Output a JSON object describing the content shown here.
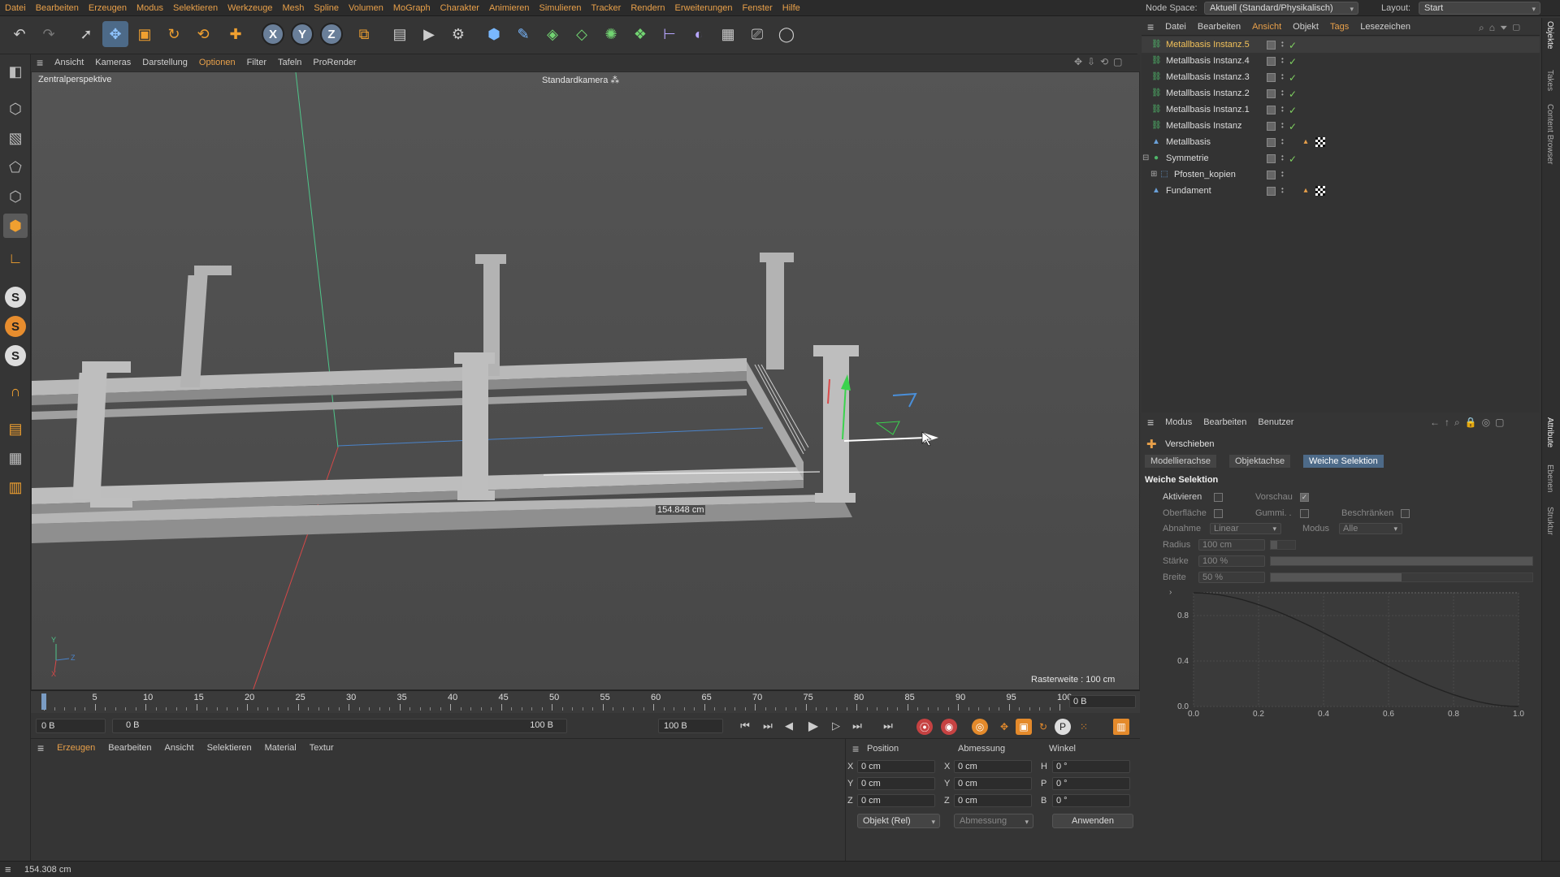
{
  "menubar": {
    "items": [
      "Datei",
      "Bearbeiten",
      "Erzeugen",
      "Modus",
      "Selektieren",
      "Werkzeuge",
      "Mesh",
      "Spline",
      "Volumen",
      "MoGraph",
      "Charakter",
      "Animieren",
      "Simulieren",
      "Tracker",
      "Rendern",
      "Erweiterungen",
      "Fenster",
      "Hilfe"
    ],
    "node_space_label": "Node Space:",
    "node_space_value": "Aktuell (Standard/Physikalisch)",
    "layout_label": "Layout:",
    "layout_value": "Start"
  },
  "viewport": {
    "menu": [
      "Ansicht",
      "Kameras",
      "Darstellung",
      "Optionen",
      "Filter",
      "Tafeln",
      "ProRender"
    ],
    "highlight_menu": "Optionen",
    "title": "Zentralperspektive",
    "camera": "Standardkamera",
    "grid_info": "Rasterweite : 100 cm",
    "measure": "154.848 cm",
    "axis_y": "Y",
    "axis_z": "Z",
    "axis_x": "X"
  },
  "timeline": {
    "ticks": [
      "0",
      "5",
      "10",
      "15",
      "20",
      "25",
      "30",
      "35",
      "40",
      "45",
      "50",
      "55",
      "60",
      "65",
      "70",
      "75",
      "80",
      "85",
      "90",
      "95",
      "100"
    ],
    "current_frame": "0 B"
  },
  "transport": {
    "start_field": "0 B",
    "range_start": "0 B",
    "range_end": "100 B",
    "end_field": "100 B"
  },
  "material_manager": {
    "menu": [
      "Erzeugen",
      "Bearbeiten",
      "Ansicht",
      "Selektieren",
      "Material",
      "Textur"
    ]
  },
  "coord_manager": {
    "headers": [
      "Position",
      "Abmessung",
      "Winkel"
    ],
    "pos": [
      {
        "axis": "X",
        "value": "0 cm"
      },
      {
        "axis": "Y",
        "value": "0 cm"
      },
      {
        "axis": "Z",
        "value": "0 cm"
      }
    ],
    "size": [
      {
        "axis": "X",
        "value": "0 cm"
      },
      {
        "axis": "Y",
        "value": "0 cm"
      },
      {
        "axis": "Z",
        "value": "0 cm"
      }
    ],
    "rot": [
      {
        "axis": "H",
        "value": "0 °"
      },
      {
        "axis": "P",
        "value": "0 °"
      },
      {
        "axis": "B",
        "value": "0 °"
      }
    ],
    "mode_select": "Objekt (Rel)",
    "size_select": "Abmessung",
    "apply": "Anwenden"
  },
  "status": {
    "text": "154.308 cm"
  },
  "object_manager": {
    "menu": [
      "Datei",
      "Bearbeiten",
      "Ansicht",
      "Objekt",
      "Tags",
      "Lesezeichen"
    ],
    "objects": [
      {
        "name": "Metallbasis Instanz.5",
        "selected": true,
        "icon": "instance-icon"
      },
      {
        "name": "Metallbasis Instanz.4",
        "selected": false,
        "icon": "instance-icon"
      },
      {
        "name": "Metallbasis Instanz.3",
        "selected": false,
        "icon": "instance-icon"
      },
      {
        "name": "Metallbasis Instanz.2",
        "selected": false,
        "icon": "instance-icon"
      },
      {
        "name": "Metallbasis Instanz.1",
        "selected": false,
        "icon": "instance-icon"
      },
      {
        "name": "Metallbasis Instanz",
        "selected": false,
        "icon": "instance-icon"
      },
      {
        "name": "Metallbasis",
        "selected": false,
        "icon": "polygon-object-icon"
      },
      {
        "name": "Symmetrie",
        "selected": false,
        "icon": "symmetry-icon"
      },
      {
        "name": "Pfosten_kopien",
        "selected": false,
        "icon": "null-object-icon"
      },
      {
        "name": "Fundament",
        "selected": false,
        "icon": "polygon-object-icon"
      }
    ]
  },
  "attribute_manager": {
    "menu": [
      "Modus",
      "Bearbeiten",
      "Benutzer"
    ],
    "tool_title": "Verschieben",
    "tabs": [
      "Modellierachse",
      "Objektachse",
      "Weiche Selektion"
    ],
    "active_tab": "Weiche Selektion",
    "section": "Weiche Selektion",
    "fields": {
      "aktivieren": "Aktivieren",
      "vorschau": "Vorschau",
      "oberflaeche": "Oberfläche",
      "gummi": "Gummi. .",
      "beschraenken": "Beschränken",
      "abnahme_label": "Abnahme",
      "abnahme_value": "Linear",
      "modus_label": "Modus",
      "modus_value": "Alle",
      "radius_label": "Radius",
      "radius_value": "100 cm",
      "staerke_label": "Stärke",
      "staerke_value": "100 %",
      "breite_label": "Breite",
      "breite_value": "50 %"
    },
    "levels": {
      "radius": 0.25,
      "staerke": 1.0,
      "breite": 0.5
    },
    "curve_y_ticks": [
      "0.8",
      "0.4",
      "0.0"
    ],
    "curve_x_ticks": [
      "0.0",
      "0.2",
      "0.4",
      "0.6",
      "0.8",
      "1.0"
    ]
  },
  "side_tabs": [
    "Objekte",
    "Takes",
    "Content Browser",
    "Attribute",
    "Ebenen",
    "Struktur"
  ]
}
